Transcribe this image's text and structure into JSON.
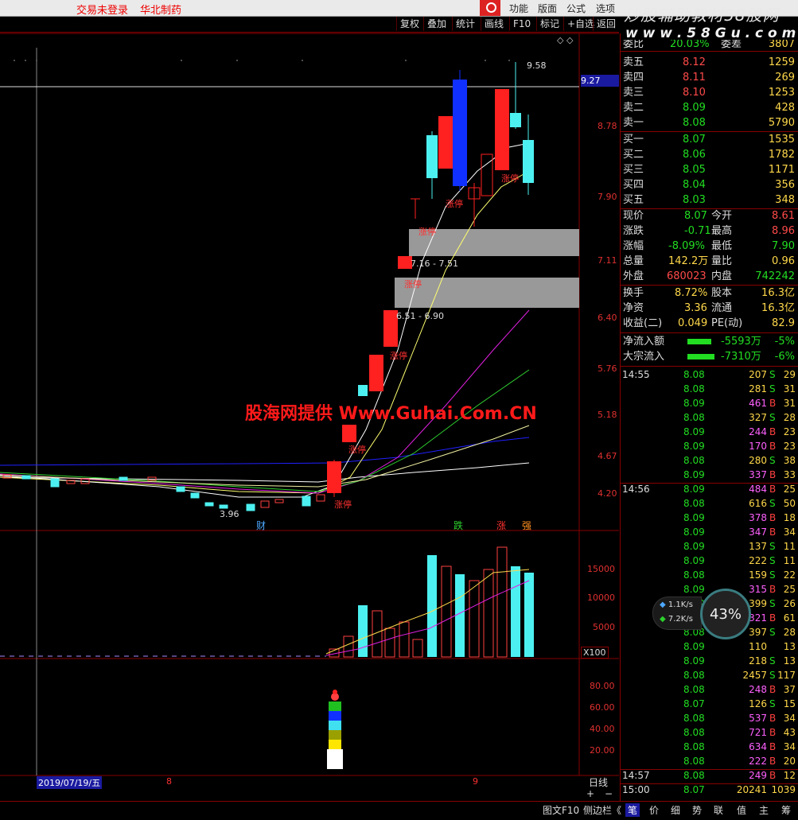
{
  "topbar": {
    "login_status": "交易未登录",
    "stock_name": "华北制药",
    "menus": [
      "功能",
      "版面",
      "公式",
      "选项"
    ]
  },
  "toolbar": {
    "buttons": [
      "复权",
      "叠加",
      "统计",
      "画线",
      "F10",
      "标记",
      "+自选",
      "返回"
    ]
  },
  "watermark": {
    "line1": "炒股辅助教材58股网",
    "line2": "w w w . 5 8 G u . c o m"
  },
  "chart": {
    "overlay_text": "股海网提供 Www.Guhai.Com.CN",
    "price_marker": "9.27",
    "high_label": "9.58",
    "low_label": "3.96",
    "range_label1": "7.16 - 7.51",
    "range_label2": "6.51 - 6.90",
    "limit_up": "涨停",
    "event_cai": "财",
    "event_die": "跌",
    "event_zhang": "涨",
    "event_qiang": "强",
    "price_ticks": [
      "8.78",
      "7.90",
      "7.11",
      "6.40",
      "5.76",
      "5.18",
      "4.67",
      "4.20"
    ],
    "vol_ticks": [
      "15000",
      "10000",
      "5000"
    ],
    "vol_unit": "X100",
    "ind_ticks": [
      "80.00",
      "60.00",
      "40.00",
      "20.00"
    ],
    "date_label": "2019/07/19/五",
    "month_8": "8",
    "month_9": "9",
    "period": "日线"
  },
  "chart_data": {
    "type": "candlestick",
    "price_range": [
      3.96,
      9.58
    ],
    "volume_axis": [
      0,
      15000,
      10000,
      5000
    ]
  },
  "quote": {
    "top_partial": {
      "label": "委比",
      "value": "20.03%",
      "label2": "委差",
      "value2": "3807"
    },
    "sells": [
      {
        "label": "卖五",
        "price": "8.12",
        "vol": "1259"
      },
      {
        "label": "卖四",
        "price": "8.11",
        "vol": "269"
      },
      {
        "label": "卖三",
        "price": "8.10",
        "vol": "1253"
      },
      {
        "label": "卖二",
        "price": "8.09",
        "vol": "428"
      },
      {
        "label": "卖一",
        "price": "8.08",
        "vol": "5790"
      }
    ],
    "buys": [
      {
        "label": "买一",
        "price": "8.07",
        "vol": "1535"
      },
      {
        "label": "买二",
        "price": "8.06",
        "vol": "1782"
      },
      {
        "label": "买三",
        "price": "8.05",
        "vol": "1171"
      },
      {
        "label": "买四",
        "price": "8.04",
        "vol": "356"
      },
      {
        "label": "买五",
        "price": "8.03",
        "vol": "348"
      }
    ],
    "stats": [
      {
        "l1": "现价",
        "v1": "8.07",
        "l2": "今开",
        "v2": "8.61"
      },
      {
        "l1": "涨跌",
        "v1": "-0.71",
        "l2": "最高",
        "v2": "8.96"
      },
      {
        "l1": "涨幅",
        "v1": "-8.09%",
        "l2": "最低",
        "v2": "7.90"
      },
      {
        "l1": "总量",
        "v1": "142.2万",
        "l2": "量比",
        "v2": "0.96"
      },
      {
        "l1": "外盘",
        "v1": "680023",
        "l2": "内盘",
        "v2": "742242"
      }
    ],
    "stats2": [
      {
        "l1": "换手",
        "v1": "8.72%",
        "l2": "股本",
        "v2": "16.3亿"
      },
      {
        "l1": "净资",
        "v1": "3.36",
        "l2": "流通",
        "v2": "16.3亿"
      },
      {
        "l1": "收益(二)",
        "v1": "0.049",
        "l2": "PE(动)",
        "v2": "82.9"
      }
    ],
    "flows": [
      {
        "label": "净流入额",
        "value": "-5593万",
        "pct": "-5%"
      },
      {
        "label": "大宗流入",
        "value": "-7310万",
        "pct": "-6%"
      }
    ]
  },
  "ticks": [
    {
      "t": "14:55",
      "p": "8.08",
      "v": "207",
      "bs": "S",
      "n": "29"
    },
    {
      "t": "",
      "p": "8.08",
      "v": "281",
      "bs": "S",
      "n": "31"
    },
    {
      "t": "",
      "p": "8.09",
      "v": "461",
      "bs": "B",
      "n": "31"
    },
    {
      "t": "",
      "p": "8.08",
      "v": "327",
      "bs": "S",
      "n": "28"
    },
    {
      "t": "",
      "p": "8.09",
      "v": "244",
      "bs": "B",
      "n": "23"
    },
    {
      "t": "",
      "p": "8.09",
      "v": "170",
      "bs": "B",
      "n": "23"
    },
    {
      "t": "",
      "p": "8.08",
      "v": "280",
      "bs": "S",
      "n": "38"
    },
    {
      "t": "",
      "p": "8.09",
      "v": "337",
      "bs": "B",
      "n": "33"
    },
    {
      "t": "14:56",
      "p": "8.09",
      "v": "484",
      "bs": "B",
      "n": "25"
    },
    {
      "t": "",
      "p": "8.08",
      "v": "616",
      "bs": "S",
      "n": "50"
    },
    {
      "t": "",
      "p": "8.09",
      "v": "378",
      "bs": "B",
      "n": "18"
    },
    {
      "t": "",
      "p": "8.09",
      "v": "347",
      "bs": "B",
      "n": "34"
    },
    {
      "t": "",
      "p": "8.09",
      "v": "137",
      "bs": "S",
      "n": "11"
    },
    {
      "t": "",
      "p": "8.09",
      "v": "222",
      "bs": "S",
      "n": "11"
    },
    {
      "t": "",
      "p": "8.08",
      "v": "159",
      "bs": "S",
      "n": "22"
    },
    {
      "t": "",
      "p": "8.09",
      "v": "315",
      "bs": "B",
      "n": "25"
    },
    {
      "t": "",
      "p": "8.09",
      "v": "399",
      "bs": "S",
      "n": "26"
    },
    {
      "t": "",
      "p": "8.09",
      "v": "321",
      "bs": "B",
      "n": "61"
    },
    {
      "t": "",
      "p": "8.08",
      "v": "397",
      "bs": "S",
      "n": "28"
    },
    {
      "t": "",
      "p": "8.09",
      "v": "110",
      "bs": "",
      "n": "13"
    },
    {
      "t": "",
      "p": "8.09",
      "v": "218",
      "bs": "S",
      "n": "13"
    },
    {
      "t": "",
      "p": "8.08",
      "v": "2457",
      "bs": "S",
      "n": "117"
    },
    {
      "t": "",
      "p": "8.08",
      "v": "248",
      "bs": "B",
      "n": "37"
    },
    {
      "t": "",
      "p": "8.07",
      "v": "126",
      "bs": "S",
      "n": "15"
    },
    {
      "t": "",
      "p": "8.08",
      "v": "537",
      "bs": "B",
      "n": "34"
    },
    {
      "t": "",
      "p": "8.08",
      "v": "721",
      "bs": "B",
      "n": "43"
    },
    {
      "t": "",
      "p": "8.08",
      "v": "634",
      "bs": "B",
      "n": "34"
    },
    {
      "t": "",
      "p": "8.08",
      "v": "222",
      "bs": "B",
      "n": "20"
    },
    {
      "t": "14:57",
      "p": "8.08",
      "v": "249",
      "bs": "B",
      "n": "12"
    },
    {
      "t": "15:00",
      "p": "8.07",
      "v": "20241",
      "bs": "",
      "n": "1039"
    }
  ],
  "speed": {
    "up": "1.1K/s",
    "down": "7.2K/s",
    "pct": "43%"
  },
  "bottom": {
    "left_tabs": [
      "图文F10",
      "侧边栏《"
    ],
    "right_tabs": [
      "笔",
      "价",
      "细",
      "势",
      "联",
      "值",
      "主",
      "筹"
    ],
    "plus": "+",
    "minus": "−"
  },
  "colors": {
    "up": "#ff2020",
    "down": "#4df0f0",
    "limit_blue": "#1030ff"
  }
}
